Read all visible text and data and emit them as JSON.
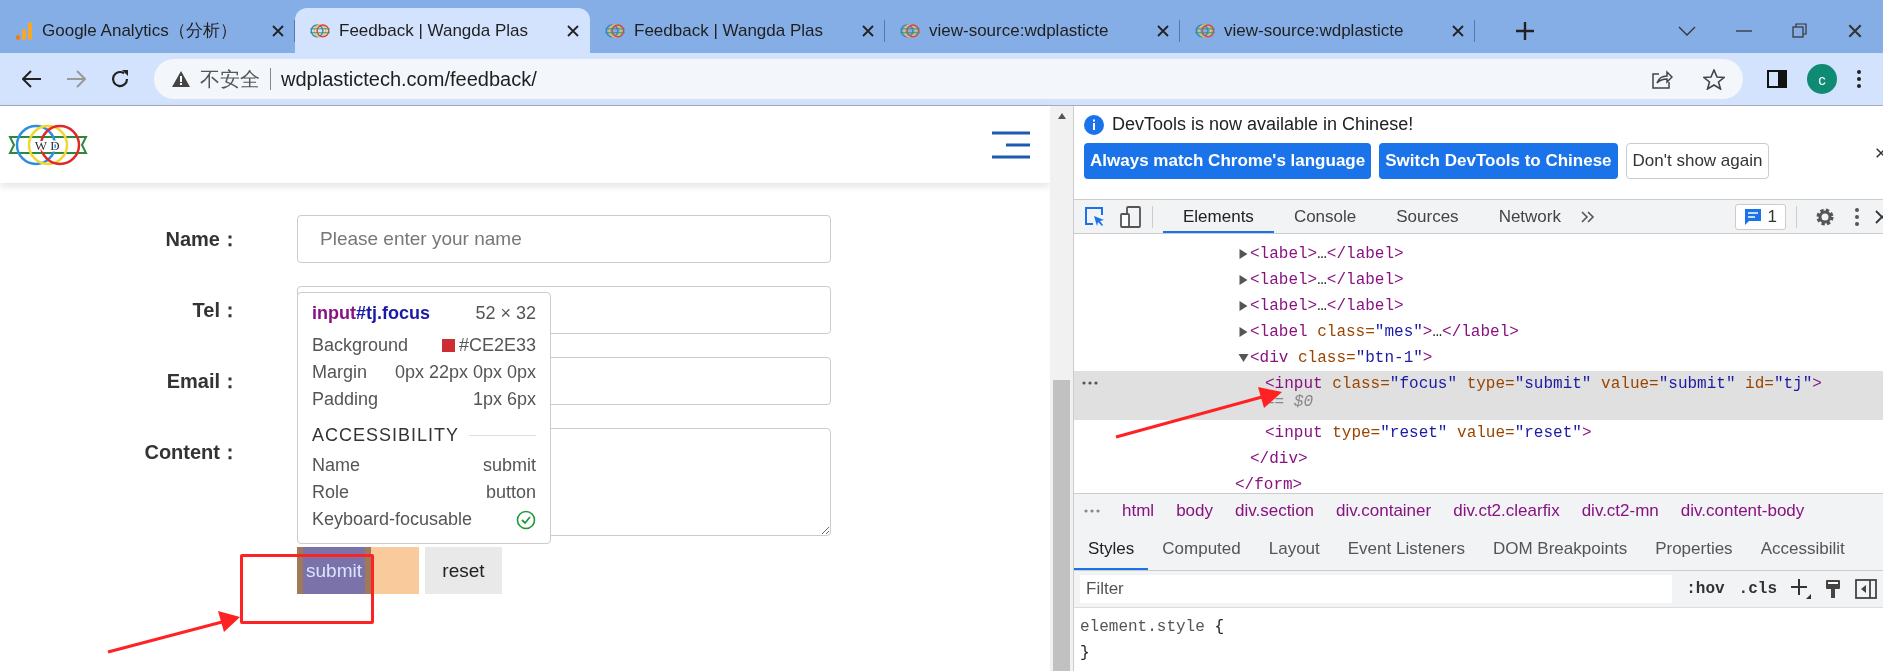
{
  "browser": {
    "tabs": [
      {
        "title": "Google Analytics（分析）",
        "kind": "analytics",
        "selected": false
      },
      {
        "title": "Feedback | Wangda Plas",
        "kind": "site",
        "selected": true
      },
      {
        "title": "Feedback | Wangda Plas",
        "kind": "site",
        "selected": false
      },
      {
        "title": "view-source:wdplasticte",
        "kind": "site",
        "selected": false
      },
      {
        "title": "view-source:wdplasticte",
        "kind": "site",
        "selected": false
      }
    ],
    "address": {
      "security": "不安全",
      "url": "wdplastictech.com/feedback/"
    },
    "profile": "c"
  },
  "page": {
    "logo": {
      "letters": [
        "W",
        "D"
      ]
    },
    "form": [
      {
        "label": "Name：",
        "kind": "input",
        "placeholder": "Please enter your name"
      },
      {
        "label": "Tel：",
        "kind": "input"
      },
      {
        "label": "Email：",
        "kind": "input"
      },
      {
        "label": "Content：",
        "kind": "textarea"
      }
    ],
    "buttons": [
      {
        "label": "submit",
        "kind": "inspected"
      },
      {
        "label": "reset",
        "kind": "plain"
      }
    ],
    "tooltip": {
      "tag": "input",
      "rest": "#tj.focus",
      "size": "52 × 32",
      "props": [
        {
          "name": "Background",
          "value": "#CE2E33",
          "color": "#ce2e33"
        },
        {
          "name": "Margin",
          "value": "0px 22px 0px 0px"
        },
        {
          "name": "Padding",
          "value": "1px 6px"
        }
      ],
      "section": "ACCESSIBILITY",
      "accessibility": [
        {
          "name": "Name",
          "value": "submit"
        },
        {
          "name": "Role",
          "value": "button"
        },
        {
          "name": "Keyboard-focusable",
          "checked": true
        }
      ]
    }
  },
  "devtools": {
    "notice": "DevTools is now available in Chinese!",
    "notice_buttons": [
      {
        "label": "Always match Chrome's language",
        "kind": "primary"
      },
      {
        "label": "Switch DevTools to Chinese",
        "kind": "primary"
      },
      {
        "label": "Don't show again",
        "kind": "secondary"
      }
    ],
    "tabs": [
      {
        "label": "Elements",
        "selected": true
      },
      {
        "label": "Console",
        "selected": false
      },
      {
        "label": "Sources",
        "selected": false
      },
      {
        "label": "Network",
        "selected": false
      }
    ],
    "issues_count": "1",
    "tree": {
      "children": [
        {
          "tokens": [
            {
              "kind": "tag",
              "text": "<label>"
            },
            {
              "kind": "text",
              "text": "…"
            },
            {
              "kind": "tag",
              "text": "</label>"
            }
          ],
          "expanded": false,
          "selected": false
        },
        {
          "tokens": [
            {
              "kind": "tag",
              "text": "<label>"
            },
            {
              "kind": "text",
              "text": "…"
            },
            {
              "kind": "tag",
              "text": "</label>"
            }
          ],
          "expanded": false,
          "selected": false
        },
        {
          "tokens": [
            {
              "kind": "tag",
              "text": "<label>"
            },
            {
              "kind": "text",
              "text": "…"
            },
            {
              "kind": "tag",
              "text": "</label>"
            }
          ],
          "expanded": false,
          "selected": false
        },
        {
          "tokens": [
            {
              "kind": "tag",
              "text": "<label"
            },
            {
              "kind": "attr",
              "text": " class="
            },
            {
              "kind": "value",
              "text": "\"mes\""
            },
            {
              "kind": "tag",
              "text": ">"
            },
            {
              "kind": "text",
              "text": "…"
            },
            {
              "kind": "tag",
              "text": "</label>"
            }
          ],
          "expanded": false,
          "selected": false
        },
        {
          "tokens": [
            {
              "kind": "tag",
              "text": "<div"
            },
            {
              "kind": "attr",
              "text": " class="
            },
            {
              "kind": "value",
              "text": "\"btn-1\""
            },
            {
              "kind": "tag",
              "text": ">"
            }
          ],
          "expanded": true,
          "selected": false,
          "children": [
            {
              "tokens": [
                {
                  "kind": "tag",
                  "text": "<input"
                },
                {
                  "kind": "attr",
                  "text": " class="
                },
                {
                  "kind": "value",
                  "text": "\"focus\""
                },
                {
                  "kind": "attr",
                  "text": " type="
                },
                {
                  "kind": "value",
                  "text": "\"submit\""
                },
                {
                  "kind": "attr",
                  "text": " value="
                },
                {
                  "kind": "value",
                  "text": "\"submit\""
                },
                {
                  "kind": "attr",
                  "text": " id="
                },
                {
                  "kind": "value",
                  "text": "\"tj\""
                },
                {
                  "kind": "tag",
                  "text": ">"
                }
              ],
              "selected": true,
              "console_ref": "== $0"
            },
            {
              "tokens": [
                {
                  "kind": "tag",
                  "text": "<input"
                },
                {
                  "kind": "attr",
                  "text": " type="
                },
                {
                  "kind": "value",
                  "text": "\"reset\""
                },
                {
                  "kind": "attr",
                  "text": " value="
                },
                {
                  "kind": "value",
                  "text": "\"reset\""
                },
                {
                  "kind": "tag",
                  "text": ">"
                }
              ],
              "selected": false
            }
          ],
          "close": [
            {
              "kind": "tag",
              "text": "</div>"
            }
          ]
        }
      ],
      "close": [
        {
          "kind": "tag",
          "text": "</form>"
        }
      ]
    },
    "breadcrumbs": [
      "html",
      "body",
      "div.section",
      "div.container",
      "div.ct2.clearfix",
      "div.ct2-mn",
      "div.content-body"
    ],
    "style_tabs": [
      {
        "label": "Styles",
        "selected": true
      },
      {
        "label": "Computed",
        "selected": false
      },
      {
        "label": "Layout",
        "selected": false
      },
      {
        "label": "Event Listeners",
        "selected": false
      },
      {
        "label": "DOM Breakpoints",
        "selected": false
      },
      {
        "label": "Properties",
        "selected": false
      },
      {
        "label": "Accessibilit",
        "selected": false
      }
    ],
    "filter_placeholder": "Filter",
    "style_buttons": [
      ":hov",
      ".cls"
    ],
    "rule": {
      "selector": "element.style",
      "open": "{",
      "close": "}"
    }
  }
}
